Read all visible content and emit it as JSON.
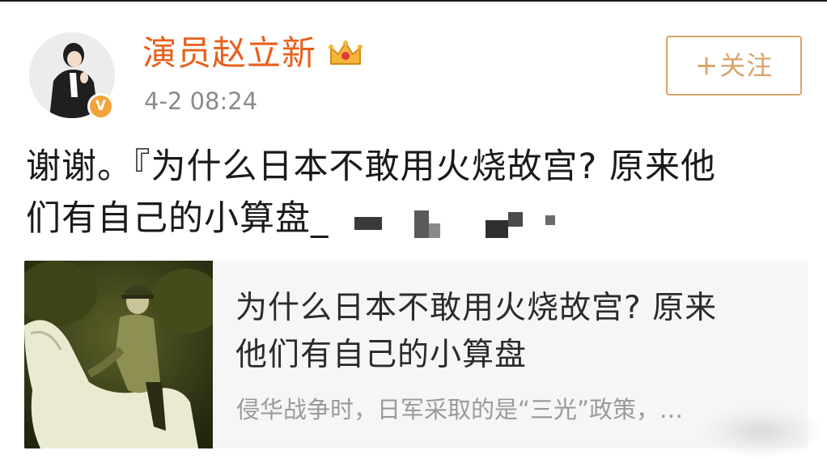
{
  "header": {
    "username": "演员赵立新",
    "timestamp": "4-2 08:24",
    "follow_button": {
      "plus": "+",
      "label": "关注"
    }
  },
  "post": {
    "text_line1": "谢谢。『为什么日本不敢用火烧故宫? 原来他",
    "text_line2": "们有自己的小算盘_"
  },
  "card": {
    "title_line1": "为什么日本不敢用火烧故宫? 原来",
    "title_line2": "他们有自己的小算盘",
    "description": "侵华战争时，日军采取的是“三光”政策，…"
  },
  "colors": {
    "username": "#e8601c",
    "follow_border": "#d9a46a",
    "verified_badge": "#f2a33a",
    "text": "#1a1a1a",
    "meta": "#8a8a8a"
  },
  "icons": {
    "verified": "verified-v-icon",
    "crown": "crown-icon",
    "plus": "plus-icon"
  }
}
